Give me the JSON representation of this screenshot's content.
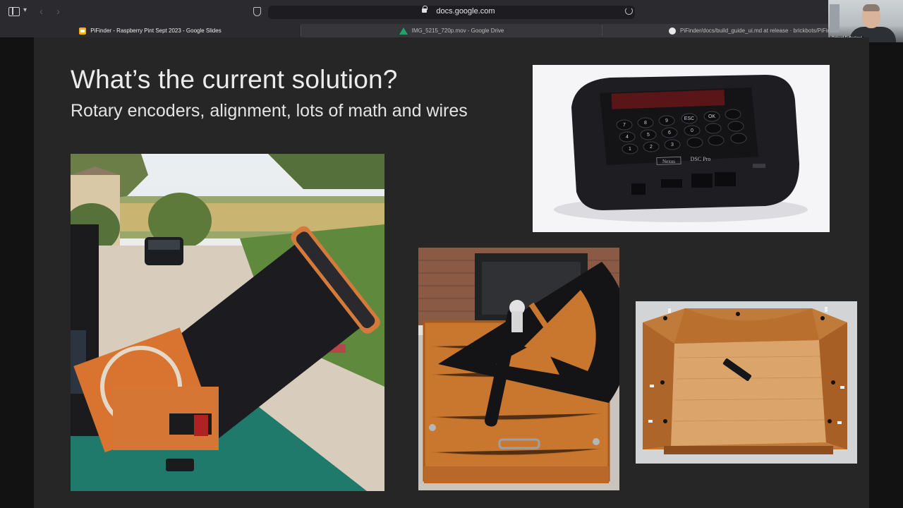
{
  "browser": {
    "url": "docs.google.com",
    "tabs": [
      {
        "label": "PiFinder - Raspberry Pint Sept 2023 - Google Slides",
        "icon": "slides-icon",
        "active": true
      },
      {
        "label": "IMG_5215_720p.mov - Google Drive",
        "icon": "drive-icon",
        "active": false
      },
      {
        "label": "PiFinder/docs/build_guide_ui.md at release · brickbots/PiFinde",
        "icon": "github-icon",
        "active": false
      }
    ]
  },
  "video": {
    "participant_name": "Richard Sutherland"
  },
  "slide": {
    "title": "What’s the current solution?",
    "subtitle": "Rotary encoders, alignment, lots of math and wires",
    "images": [
      {
        "name": "dobsonian-telescope-photo"
      },
      {
        "name": "dsc-pro-controller-photo",
        "brand": "Nexus",
        "model": "DSC Pro",
        "keys": [
          "7",
          "8",
          "9",
          "ESC",
          "OK",
          "4",
          "5",
          "6",
          "0",
          "1",
          "2",
          "3"
        ]
      },
      {
        "name": "altitude-encoder-arc-photo"
      },
      {
        "name": "rocker-box-encoder-photo"
      }
    ]
  },
  "colors": {
    "slide_bg": "#262626",
    "title_text": "#ececec",
    "chrome_bg": "#2b2a2e"
  }
}
